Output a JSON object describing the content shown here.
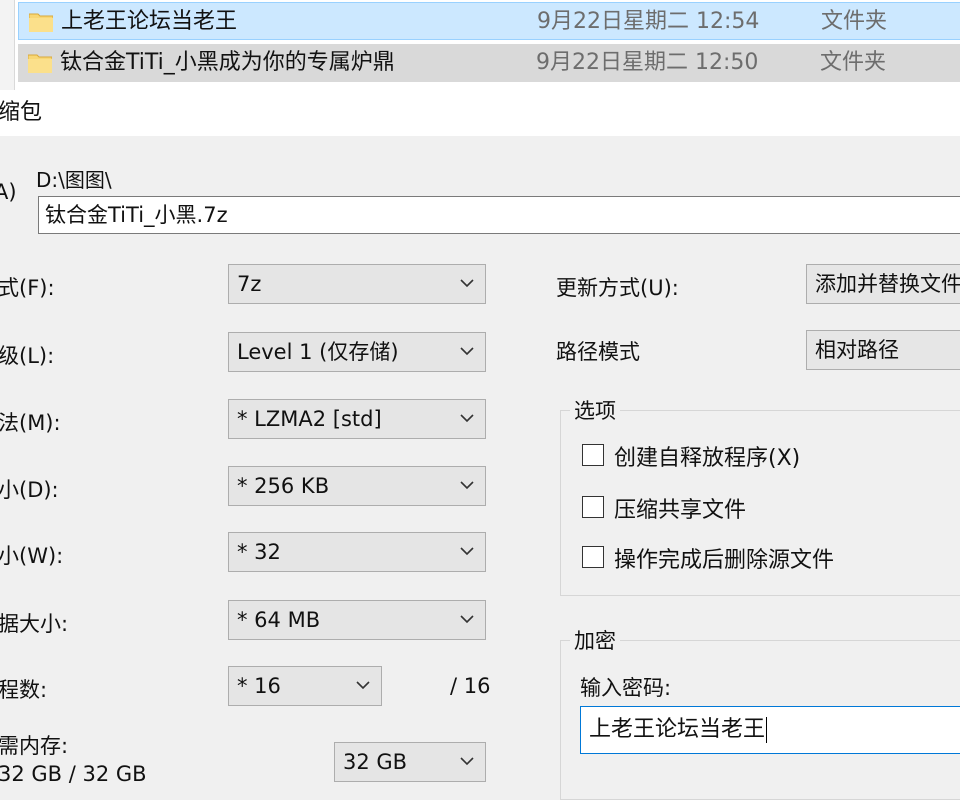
{
  "explorer": {
    "files": [
      {
        "name": "上老王论坛当老王",
        "date": "9月22日星期二 12:54",
        "type": "文件夹"
      },
      {
        "name": "钛合金TiTi_小黑成为你的专属炉鼎",
        "date": "9月22日星期二 12:50",
        "type": "文件夹"
      }
    ]
  },
  "dialog": {
    "title": "缩包",
    "archive_label": "A)",
    "archive_path": "D:\\图图\\",
    "archive_name": "钛合金TiTi_小黑.7z",
    "left_fields": [
      {
        "label": "式(F):",
        "value": "7z"
      },
      {
        "label": "级(L):",
        "value": "Level 1 (仅存储)"
      },
      {
        "label": "法(M):",
        "value": "* LZMA2 [std]"
      },
      {
        "label": "小(D):",
        "value": "* 256 KB"
      },
      {
        "label": "小(W):",
        "value": "* 32"
      },
      {
        "label": "据大小:",
        "value": "* 64 MB"
      }
    ],
    "threads": {
      "label": "程数:",
      "value": "* 16",
      "max": "/ 16"
    },
    "memory": {
      "label": "需内存:",
      "usage": "32 GB / 32 GB",
      "value": "32 GB"
    },
    "update_mode": {
      "label": "更新方式(U):",
      "value": "添加并替换文件"
    },
    "path_mode": {
      "label": "路径模式",
      "value": "相对路径"
    },
    "options": {
      "title": "选项",
      "items": [
        {
          "label": "创建自释放程序(X)",
          "checked": false
        },
        {
          "label": "压缩共享文件",
          "checked": false
        },
        {
          "label": "操作完成后删除源文件",
          "checked": false
        }
      ]
    },
    "encryption": {
      "title": "加密",
      "password_label": "输入密码:",
      "password_value": "上老王论坛当老王"
    }
  },
  "colors": {
    "selection": "#cce8ff",
    "selection_border": "#99d1ff",
    "focus_border": "#0078d7"
  }
}
